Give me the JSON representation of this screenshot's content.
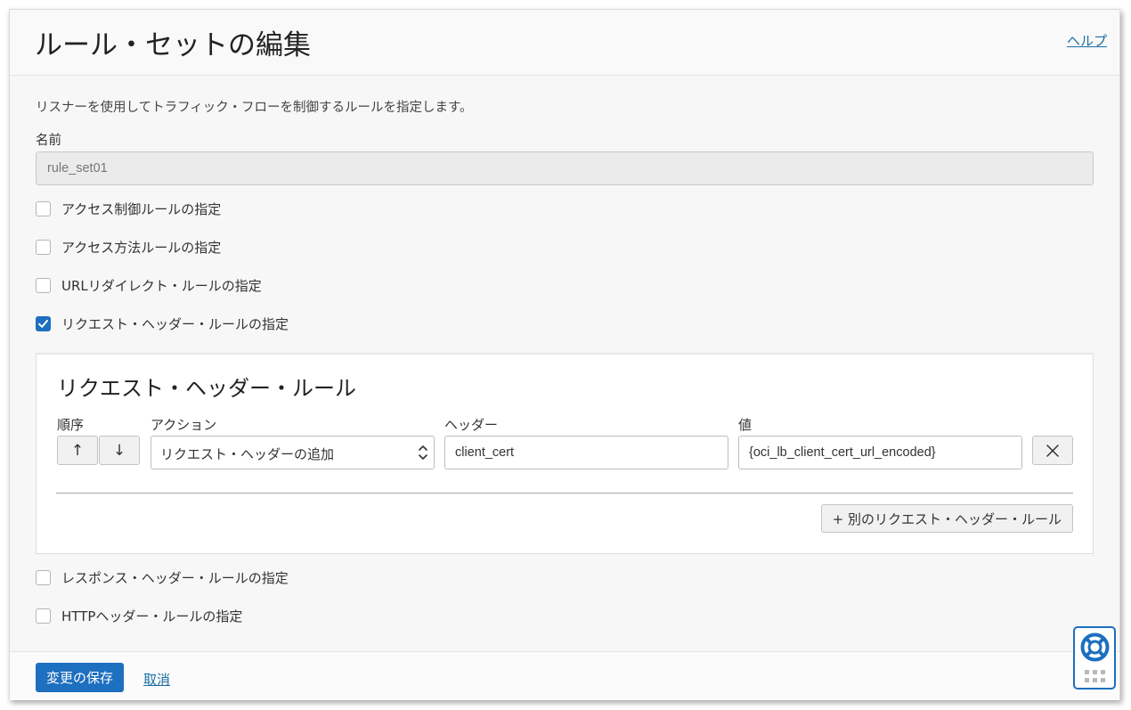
{
  "header": {
    "title": "ルール・セットの編集",
    "help_label": "ヘルプ"
  },
  "form": {
    "description": "リスナーを使用してトラフィック・フローを制御するルールを指定します。",
    "name_label": "名前",
    "name_value": "rule_set01",
    "checkboxes": [
      {
        "label": "アクセス制御ルールの指定",
        "checked": false
      },
      {
        "label": "アクセス方法ルールの指定",
        "checked": false
      },
      {
        "label": "URLリダイレクト・ルールの指定",
        "checked": false
      },
      {
        "label": "リクエスト・ヘッダー・ルールの指定",
        "checked": true
      },
      {
        "label": "レスポンス・ヘッダー・ルールの指定",
        "checked": false
      },
      {
        "label": "HTTPヘッダー・ルールの指定",
        "checked": false
      }
    ]
  },
  "rule_card": {
    "title": "リクエスト・ヘッダー・ルール",
    "columns": {
      "order": "順序",
      "action": "アクション",
      "header": "ヘッダー",
      "value": "値"
    },
    "row": {
      "up_glyph": "↑",
      "down_glyph": "↓",
      "action_selected": "リクエスト・ヘッダーの追加",
      "header_value": "client_cert",
      "value_value": "{oci_lb_client_cert_url_encoded}"
    },
    "add_button_label": "+ 別のリクエスト・ヘッダー・ルール"
  },
  "footer": {
    "save_label": "変更の保存",
    "cancel_label": "取消"
  },
  "colors": {
    "accent": "#1d6fbf",
    "link": "#1a6ea5"
  },
  "icons": [
    "checkmark-icon",
    "chevron-updown-icon",
    "close-icon",
    "lifebuoy-icon",
    "grip-icon"
  ]
}
